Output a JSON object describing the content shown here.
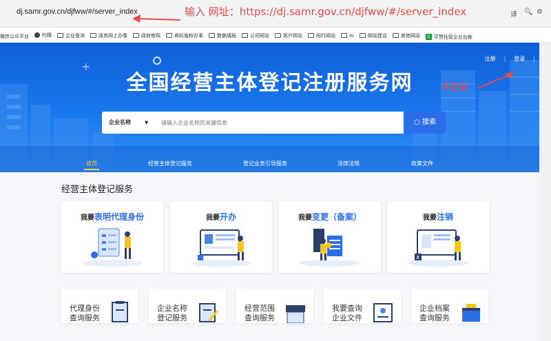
{
  "browser": {
    "url": "dj.samr.gov.cn/djfww/#/server_index",
    "annotation": "输入 网址：https://dj.samr.gov.cn/djfww/#/server_index",
    "icons": [
      "translate-icon",
      "zoom-icon",
      "settings-icon"
    ]
  },
  "bookmarks": [
    {
      "label": "微信公众平台",
      "icon": "none"
    },
    {
      "label": "扫描",
      "icon": "dot"
    },
    {
      "label": "企业查询",
      "icon": "folder"
    },
    {
      "label": "政务网上办事",
      "icon": "folder"
    },
    {
      "label": "政府官网",
      "icon": "folder"
    },
    {
      "label": "商标版权办事",
      "icon": "folder"
    },
    {
      "label": "数据填报",
      "icon": "folder"
    },
    {
      "label": "公司网站",
      "icon": "folder"
    },
    {
      "label": "客户网站",
      "icon": "folder"
    },
    {
      "label": "同行网站",
      "icon": "folder"
    },
    {
      "label": "AI",
      "icon": "folder"
    },
    {
      "label": "网站建设",
      "icon": "folder"
    },
    {
      "label": "其他网站",
      "icon": "folder"
    },
    {
      "label": "亨赞托管企业台帐",
      "icon": "green"
    }
  ],
  "header": {
    "title": "全国经营主体登记注册服务网",
    "register": "注册",
    "login": "登录",
    "login_annotation": "点登录"
  },
  "search": {
    "type": "企业名称",
    "placeholder": "请输入企业名称的关键信息",
    "button": "搜索"
  },
  "nav": [
    "首页",
    "经营主体登记服务",
    "登记业务引导服务",
    "法律法规",
    "政策文件"
  ],
  "section": {
    "title": "经营主体登记服务",
    "cards": [
      {
        "prefix": "我要",
        "highlight": "表明代理身份"
      },
      {
        "prefix": "我要",
        "highlight": "开办"
      },
      {
        "prefix": "我要",
        "highlight": "变更（备案）"
      },
      {
        "prefix": "我要",
        "highlight": "注销"
      }
    ],
    "quick": [
      {
        "line1": "代理身份",
        "line2": "查询服务"
      },
      {
        "line1": "企业名称",
        "line2": "登记服务"
      },
      {
        "line1": "经营范围",
        "line2": "查询服务"
      },
      {
        "line1": "我要查询",
        "line2": "企业文件"
      },
      {
        "line1": "企业档案",
        "line2": "查询服务"
      }
    ]
  },
  "colors": {
    "primary": "#2c6ee8",
    "annotation": "#e84a4a",
    "nav_active": "#ffd23c"
  }
}
